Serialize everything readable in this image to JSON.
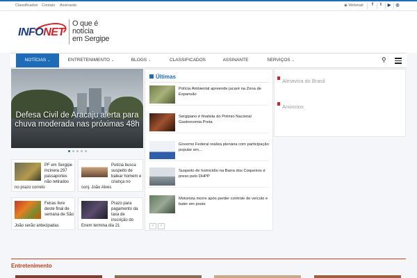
{
  "topbar": {
    "links": [
      "Classificados",
      "Contato",
      "Assinante"
    ],
    "webmail": "Webmail",
    "social_icons": [
      "facebook-icon",
      "twitter-icon",
      "youtube-icon",
      "instagram-icon"
    ]
  },
  "brand": {
    "logo_text_a": "INFO",
    "logo_text_b": "NET",
    "tagline_1": "O que é",
    "tagline_2": "notícia",
    "tagline_3": "em Sergipe",
    "accent": "#1e6bb8",
    "logo_red": "#d62027"
  },
  "nav": {
    "items": [
      {
        "label": "NOTÍCIAS",
        "has_dropdown": true,
        "active": true
      },
      {
        "label": "ENTRETENIMENTO",
        "has_dropdown": true,
        "active": false
      },
      {
        "label": "BLOGS",
        "has_dropdown": true,
        "active": false
      },
      {
        "label": "CLASSIFICADOS",
        "has_dropdown": false,
        "active": false
      },
      {
        "label": "ASSINANTE",
        "has_dropdown": false,
        "active": false
      },
      {
        "label": "SERVIÇOS",
        "has_dropdown": true,
        "active": false
      }
    ]
  },
  "slider": {
    "caption": "Defesa Civil de Aracaju alerta para chuva moderada nas próximas 48h",
    "slide_count": 5,
    "current_slide": 1
  },
  "cards": [
    {
      "text_top": "PF em Sergipe incinera 297 passaportes não retirados",
      "text_bottom": "no prazo correto"
    },
    {
      "text_top": "Polícia busca suspeito de balear homem e criança no",
      "text_bottom": "conj. João Alves"
    },
    {
      "text_top": "Feiras livre deste final de semana de São",
      "text_bottom": "João serão antecipadas"
    },
    {
      "text_top": "Prazo para pagamento da taxa de inscrição do",
      "text_bottom": "Enem termina dia 21"
    }
  ],
  "latest": {
    "title": "Últimas",
    "items": [
      "Polícia Ambiental apreende jacaré na Zona de Expansão",
      "Sergipano é finalista do Prêmio Nacional Gastronomia Preta",
      "Governo Federal realiza plenária com participação popular em...",
      "Suspeito de homicídio na Barra dos Coqueiros é preso pelo DHPP",
      "Motorista morre após perder controle de veículo e bater em poste"
    ],
    "prev": "‹",
    "next": "›"
  },
  "sidebar": {
    "links": [
      "Almaviva do Brasil",
      "Anúncios"
    ]
  },
  "sections": {
    "entertainment": "Entretenimento"
  }
}
